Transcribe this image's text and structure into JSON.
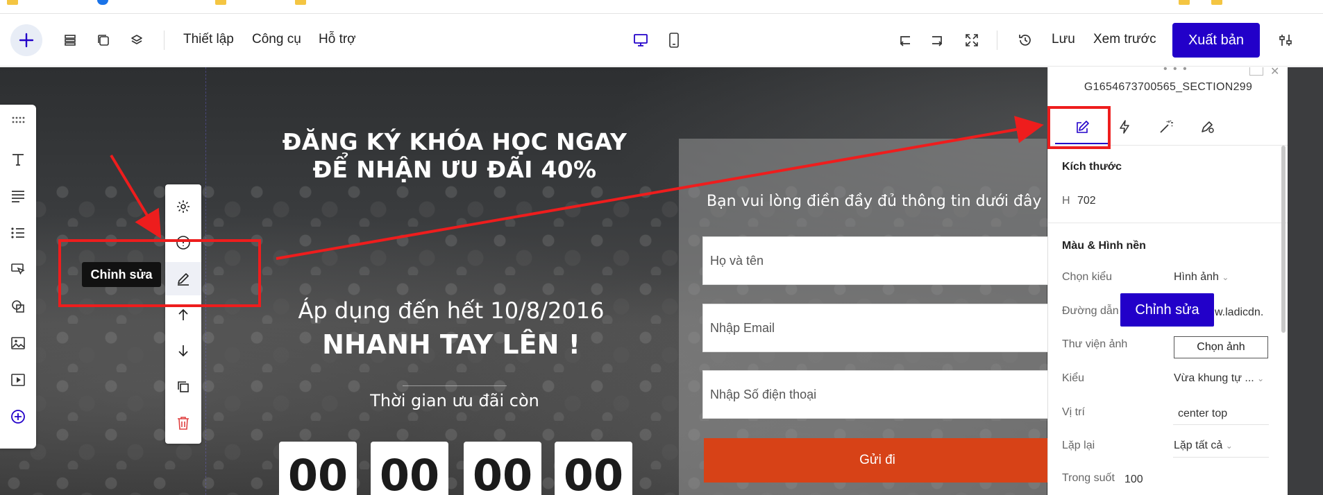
{
  "toolbar": {
    "menu_setup": "Thiết lập",
    "menu_tools": "Công cụ",
    "menu_help": "Hỗ trợ",
    "save_label": "Lưu",
    "preview_label": "Xem trước",
    "publish_label": "Xuất bản",
    "icons": [
      "add-icon",
      "sections-icon",
      "pages-icon",
      "layers-icon",
      "desktop-icon",
      "mobile-icon",
      "undo-icon",
      "redo-icon",
      "fullscreen-icon",
      "history-icon",
      "settings-sliders-icon"
    ]
  },
  "canvas": {
    "headline_line1": "ĐĂNG KÝ KHÓA HỌC NGAY",
    "headline_line2": "ĐỂ NHẬN ƯU ĐÃI 40%",
    "apply_until": "Áp dụng đến hết 10/8/2016",
    "hurry": "NHANH TAY LÊN !",
    "countdown_title": "Thời gian ưu đãi còn",
    "countdown": [
      "00",
      "00",
      "00",
      "00"
    ]
  },
  "form": {
    "title": "Bạn vui lòng điền đầy đủ thông tin dưới đây",
    "name_placeholder": "Họ và tên",
    "email_placeholder": "Nhập Email",
    "phone_placeholder": "Nhập Số điện thoại",
    "submit_label": "Gửi đi"
  },
  "element_actions": {
    "tooltip": "Chỉnh sửa"
  },
  "right_panel": {
    "element_id": "G1654673700565_SECTION299",
    "size_section": "Kích thước",
    "height_label": "H",
    "height_value": "702",
    "bg_section": "Màu & Hình nền",
    "rows": {
      "style_label": "Chọn kiểu",
      "style_value": "Hình ảnh",
      "path_label": "Đường dẫn",
      "path_value": "w.ladicdn.",
      "library_label": "Thư viện ảnh",
      "library_button": "Chọn ảnh",
      "fit_label": "Kiểu",
      "fit_value": "Vừa khung tự ...",
      "position_label": "Vị trí",
      "position_value": "center top",
      "repeat_label": "Lặp lại",
      "repeat_value": "Lặp tất cả",
      "opacity_label": "Trong suốt",
      "opacity_value": "100"
    },
    "edit_badge": "Chỉnh sửa"
  },
  "colors": {
    "accent": "#2200c9",
    "highlight": "#ee1d1d",
    "submit": "#d74217"
  }
}
